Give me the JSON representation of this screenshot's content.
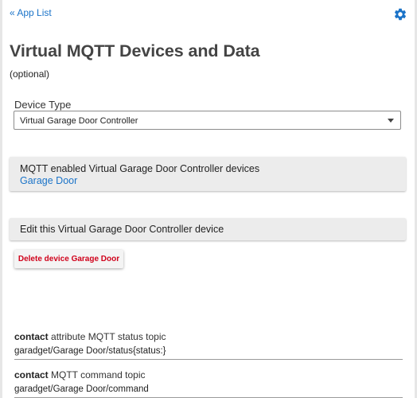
{
  "nav": {
    "back_label": "« App List"
  },
  "header": {
    "settings_icon": "gear-icon",
    "accent_color": "#1a73c8"
  },
  "page": {
    "title": "Virtual MQTT Devices and Data",
    "subtitle": "(optional)"
  },
  "device_type": {
    "label": "Device Type",
    "selected": "Virtual Garage Door Controller"
  },
  "devices_panel": {
    "title": "MQTT enabled Virtual Garage Door Controller devices",
    "devices": [
      "Garage Door"
    ]
  },
  "edit_panel": {
    "title": "Edit this Virtual Garage Door Controller device"
  },
  "delete_button": {
    "label": "Delete device Garage Door",
    "color": "#d0021b"
  },
  "settings": {
    "contact_status": {
      "attribute": "contact",
      "label_rest": " attribute MQTT status topic",
      "value": "garadget/Garage Door/status{status:}"
    },
    "contact_command": {
      "attribute": "contact",
      "label_rest": " MQTT command topic",
      "value": "garadget/Garage Door/command"
    }
  }
}
